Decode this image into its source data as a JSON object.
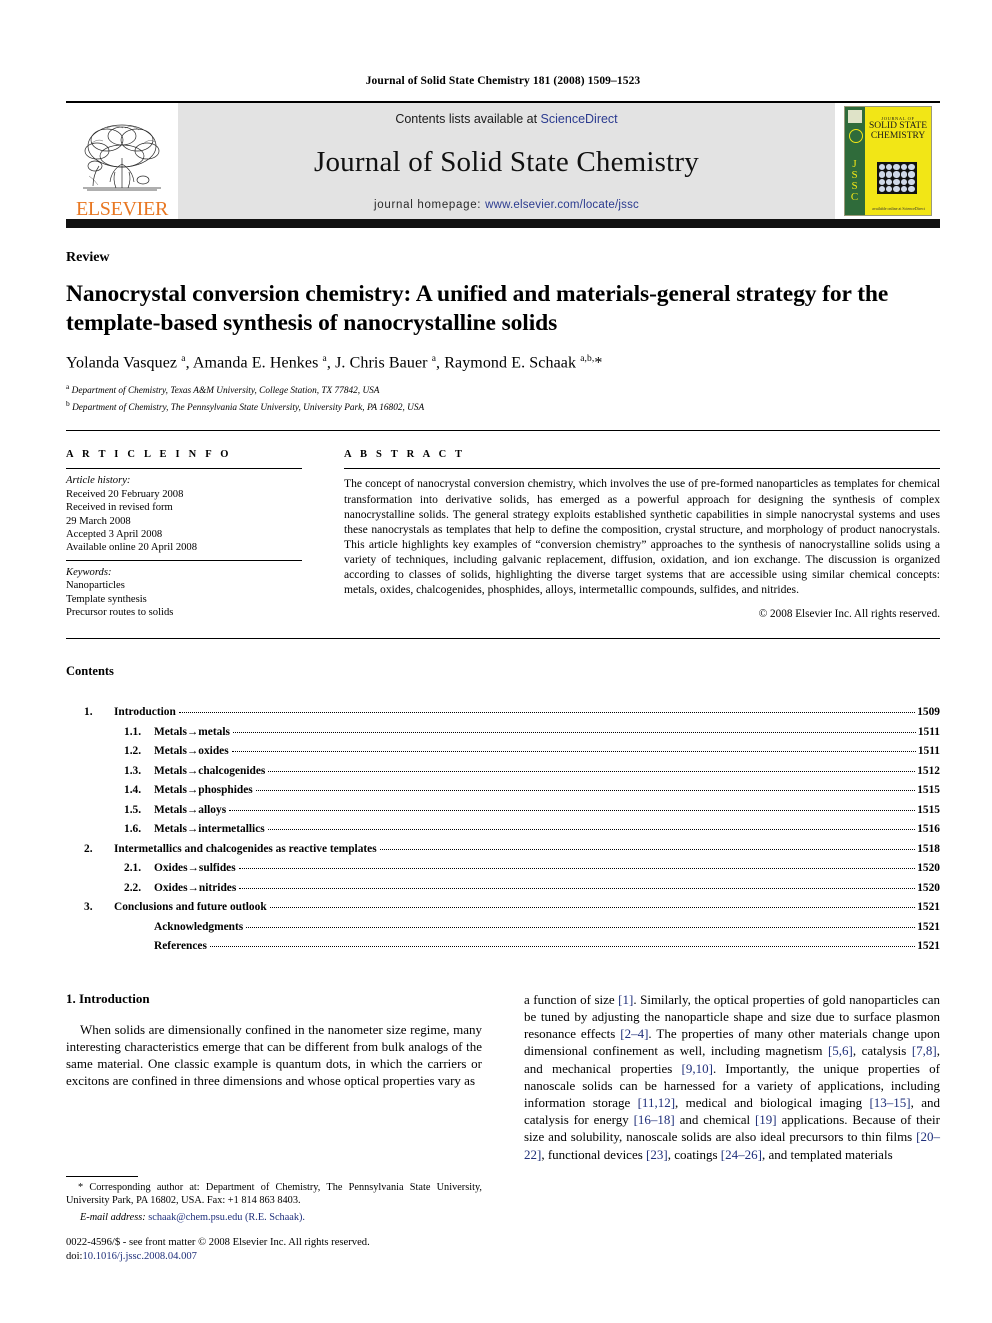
{
  "running_head": "Journal of Solid State Chemistry 181 (2008) 1509–1523",
  "masthead": {
    "contents_prefix": "Contents lists available at ",
    "sciencedirect": "ScienceDirect",
    "journal_title": "Journal of Solid State Chemistry",
    "homepage_prefix": "journal homepage: ",
    "homepage_url": "www.elsevier.com/locate/jssc",
    "publisher_wordmark": "ELSEVIER",
    "publisher_logo_icon": "elsevier-tree-icon",
    "cover": {
      "title_top": "JOURNAL OF",
      "title_main_1": "SOLID STATE",
      "title_main_2": "CHEMISTRY",
      "spine_letters": "JSSC",
      "footer": "available online at ScienceDirect",
      "bg_color": "#f2e616",
      "spine_color": "#2f6b3a"
    }
  },
  "article": {
    "type": "Review",
    "title": "Nanocrystal conversion chemistry: A unified and materials-general strategy for the template-based synthesis of nanocrystalline solids",
    "authors_html": "Yolanda Vasquez <sup>a</sup>, Amanda E. Henkes <sup>a</sup>, J. Chris Bauer <sup>a</sup>, Raymond E. Schaak <sup>a,b,</sup>*",
    "affiliations": [
      "Department of Chemistry, Texas A&M University, College Station, TX 77842, USA",
      "Department of Chemistry, The Pennsylvania State University, University Park, PA 16802, USA"
    ],
    "affiliation_marks": [
      "a",
      "b"
    ]
  },
  "info": {
    "heading": "A R T I C L E  I N F O",
    "history_label": "Article history:",
    "history": [
      "Received 20 February 2008",
      "Received in revised form",
      "29 March 2008",
      "Accepted 3 April 2008",
      "Available online 20 April 2008"
    ],
    "keywords_label": "Keywords:",
    "keywords": [
      "Nanoparticles",
      "Template synthesis",
      "Precursor routes to solids"
    ]
  },
  "abstract": {
    "heading": "A B S T R A C T",
    "text": "The concept of nanocrystal conversion chemistry, which involves the use of pre-formed nanoparticles as templates for chemical transformation into derivative solids, has emerged as a powerful approach for designing the synthesis of complex nanocrystalline solids. The general strategy exploits established synthetic capabilities in simple nanocrystal systems and uses these nanocrystals as templates that help to define the composition, crystal structure, and morphology of product nanocrystals. This article highlights key examples of “conversion chemistry” approaches to the synthesis of nanocrystalline solids using a variety of techniques, including galvanic replacement, diffusion, oxidation, and ion exchange. The discussion is organized according to classes of solids, highlighting the diverse target systems that are accessible using similar chemical concepts: metals, oxides, chalcogenides, phosphides, alloys, intermetallic compounds, sulfides, and nitrides.",
    "copyright": "© 2008 Elsevier Inc. All rights reserved."
  },
  "contents": {
    "heading": "Contents",
    "entries": [
      {
        "num": "1.",
        "label": "Introduction",
        "page": "1509",
        "level": 0
      },
      {
        "num": "1.1.",
        "label": "Metals→metals",
        "page": "1511",
        "level": 1
      },
      {
        "num": "1.2.",
        "label": "Metals→oxides",
        "page": "1511",
        "level": 1
      },
      {
        "num": "1.3.",
        "label": "Metals→chalcogenides",
        "page": "1512",
        "level": 1
      },
      {
        "num": "1.4.",
        "label": "Metals→phosphides",
        "page": "1515",
        "level": 1
      },
      {
        "num": "1.5.",
        "label": "Metals→alloys",
        "page": "1515",
        "level": 1
      },
      {
        "num": "1.6.",
        "label": "Metals→intermetallics",
        "page": "1516",
        "level": 1
      },
      {
        "num": "2.",
        "label": "Intermetallics and chalcogenides as reactive templates",
        "page": "1518",
        "level": 0
      },
      {
        "num": "2.1.",
        "label": "Oxides→sulfides",
        "page": "1520",
        "level": 1
      },
      {
        "num": "2.2.",
        "label": "Oxides→nitrides",
        "page": "1520",
        "level": 1
      },
      {
        "num": "3.",
        "label": "Conclusions and future outlook",
        "page": "1521",
        "level": 0
      },
      {
        "num": "",
        "label": "Acknowledgments",
        "page": "1521",
        "level": 2
      },
      {
        "num": "",
        "label": "References",
        "page": "1521",
        "level": 2
      }
    ]
  },
  "body": {
    "section_heading": "1.  Introduction",
    "left_paragraph": "When solids are dimensionally confined in the nanometer size regime, many interesting characteristics emerge that can be different from bulk analogs of the same material. One classic example is quantum dots, in which the carriers or excitons are confined in three dimensions and whose optical properties vary as",
    "right_paragraph_parts": [
      {
        "t": "a function of size "
      },
      {
        "t": "[1]",
        "ref": true
      },
      {
        "t": ". Similarly, the optical properties of gold nanoparticles can be tuned by adjusting the nanoparticle shape and size due to surface plasmon resonance effects "
      },
      {
        "t": "[2–4]",
        "ref": true
      },
      {
        "t": ". The properties of many other materials change upon dimensional confinement as well, including magnetism "
      },
      {
        "t": "[5,6]",
        "ref": true
      },
      {
        "t": ", catalysis "
      },
      {
        "t": "[7,8]",
        "ref": true
      },
      {
        "t": ", and mechanical properties "
      },
      {
        "t": "[9,10]",
        "ref": true
      },
      {
        "t": ". Importantly, the unique properties of nanoscale solids can be harnessed for a variety of applications, including information storage "
      },
      {
        "t": "[11,12]",
        "ref": true
      },
      {
        "t": ", medical and biological imaging "
      },
      {
        "t": "[13–15]",
        "ref": true
      },
      {
        "t": ", and catalysis for energy "
      },
      {
        "t": "[16–18]",
        "ref": true
      },
      {
        "t": " and chemical "
      },
      {
        "t": "[19]",
        "ref": true
      },
      {
        "t": " applications. Because of their size and solubility, nanoscale solids are also ideal precursors to thin films "
      },
      {
        "t": "[20–22]",
        "ref": true
      },
      {
        "t": ", functional devices "
      },
      {
        "t": "[23]",
        "ref": true
      },
      {
        "t": ", coatings "
      },
      {
        "t": "[24–26]",
        "ref": true
      },
      {
        "t": ", and templated materials"
      }
    ]
  },
  "footnotes": {
    "corresponding": "* Corresponding author at: Department of Chemistry, The Pennsylvania State University, University Park, PA 16802, USA. Fax: +1 814 863 8403.",
    "email_label": "E-mail address:",
    "email": "schaak@chem.psu.edu (R.E. Schaak).",
    "imprint_line": "0022-4596/$ - see front matter © 2008 Elsevier Inc. All rights reserved.",
    "doi_label": "doi:",
    "doi": "10.1016/j.jssc.2008.04.007"
  },
  "colors": {
    "link_blue": "#2b3b8f",
    "ref_blue": "#1f2f7a",
    "elsevier_orange": "#E87722",
    "masthead_gray": "#e3e3e3"
  }
}
